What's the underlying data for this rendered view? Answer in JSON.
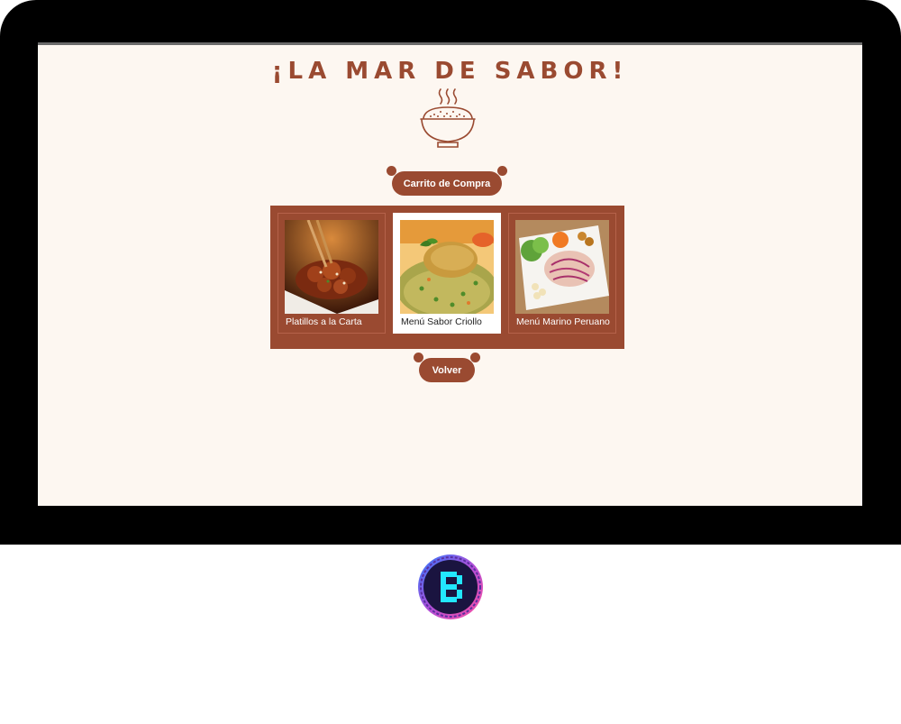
{
  "header": {
    "title": "¡LA MAR DE SABOR!",
    "icon": "steaming-bowl-icon"
  },
  "buttons": {
    "cart_label": "Carrito de Compra",
    "back_label": "Volver"
  },
  "menu_cards": [
    {
      "label": "Platillos a la Carta",
      "image": "sweet-and-sour-chicken-photo",
      "selected": false
    },
    {
      "label": "Menú Sabor Criollo",
      "image": "arroz-con-pollo-photo",
      "selected": true
    },
    {
      "label": "Menú Marino Peruano",
      "image": "ceviche-photo",
      "selected": false
    }
  ],
  "colors": {
    "accent": "#9a4a31",
    "screen_background": "#fdf7f1",
    "frame": "#000000",
    "logo_ring": "#b04fd8",
    "logo_letter": "#22e6ff"
  },
  "footer": {
    "logo_icon": "b-pixel-logo-icon"
  }
}
